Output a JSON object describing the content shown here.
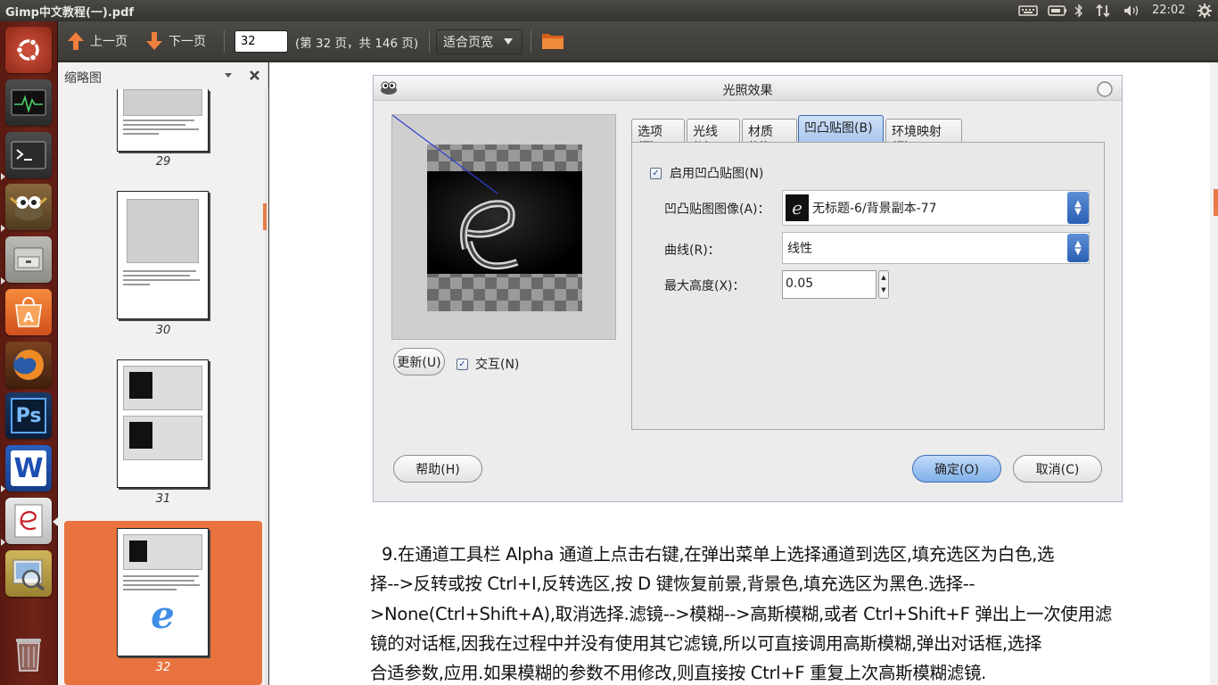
{
  "window": {
    "title": "Gimp中文教程(一).pdf"
  },
  "panel": {
    "clock": "22:02"
  },
  "launcher": {
    "items": [
      {
        "name": "ubuntu-logo"
      },
      {
        "name": "system-monitor"
      },
      {
        "name": "terminal"
      },
      {
        "name": "gimp"
      },
      {
        "name": "file-manager"
      },
      {
        "name": "software-center"
      },
      {
        "name": "firefox"
      },
      {
        "name": "photoshop",
        "label": "Ps"
      },
      {
        "name": "wps-writer",
        "label": "W"
      },
      {
        "name": "document-viewer"
      },
      {
        "name": "image-viewer"
      },
      {
        "name": "trash"
      }
    ]
  },
  "toolbar": {
    "prev_label": "上一页",
    "next_label": "下一页",
    "page_value": "32",
    "page_info": "(第 32 页，共 146 页)",
    "zoom_label": "适合页宽"
  },
  "sidebar": {
    "title": "缩略图",
    "thumbnails": [
      {
        "page": "29"
      },
      {
        "page": "30"
      },
      {
        "page": "31"
      },
      {
        "page": "32",
        "selected": true
      }
    ]
  },
  "dialog": {
    "title": "光照效果",
    "tabs": [
      "选项(T)",
      "光线(L)",
      "材质(M)",
      "凹凸贴图(B)",
      "环境映射(E)"
    ],
    "active_tab": "凹凸贴图(B)",
    "enable_bump": "启用凹凸贴图(N)",
    "bump_image_label": "凹凸贴图图像(A)：",
    "bump_image_value": "无标题-6/背景副本-77",
    "curve_label": "曲线(R)：",
    "curve_value": "线性",
    "max_height_label": "最大高度(X)：",
    "max_height_value": "0.05",
    "update_button": "更新(U)",
    "interactive_label": "交互(N)",
    "help_button": "帮助(H)",
    "ok_button": "确定(O)",
    "cancel_button": "取消(C)"
  },
  "document": {
    "lines": [
      "9.在通道工具栏 Alpha 通道上点击右键,在弹出菜单上选择通道到选区,填充选区为白色,选",
      "择-->反转或按 Ctrl+I,反转选区,按 D 键恢复前景,背景色,填充选区为黑色.选择--",
      ">None(Ctrl+Shift+A),取消选择.滤镜-->模糊-->高斯模糊,或者 Ctrl+Shift+F 弹出上一次使用滤",
      "镜的对话框,因我在过程中并没有使用其它滤镜,所以可直接调用高斯模糊,弹出对话框,选择",
      "合适参数,应用.如果模糊的参数不用修改,则直接按 Ctrl+F 重复上次高斯模糊滤镜."
    ]
  },
  "colors": {
    "accent": "#e9733f",
    "launcher_bg": "#6e2418",
    "panel_bg": "#3c3b37",
    "toolbar_arrow": "#f07f3c"
  }
}
